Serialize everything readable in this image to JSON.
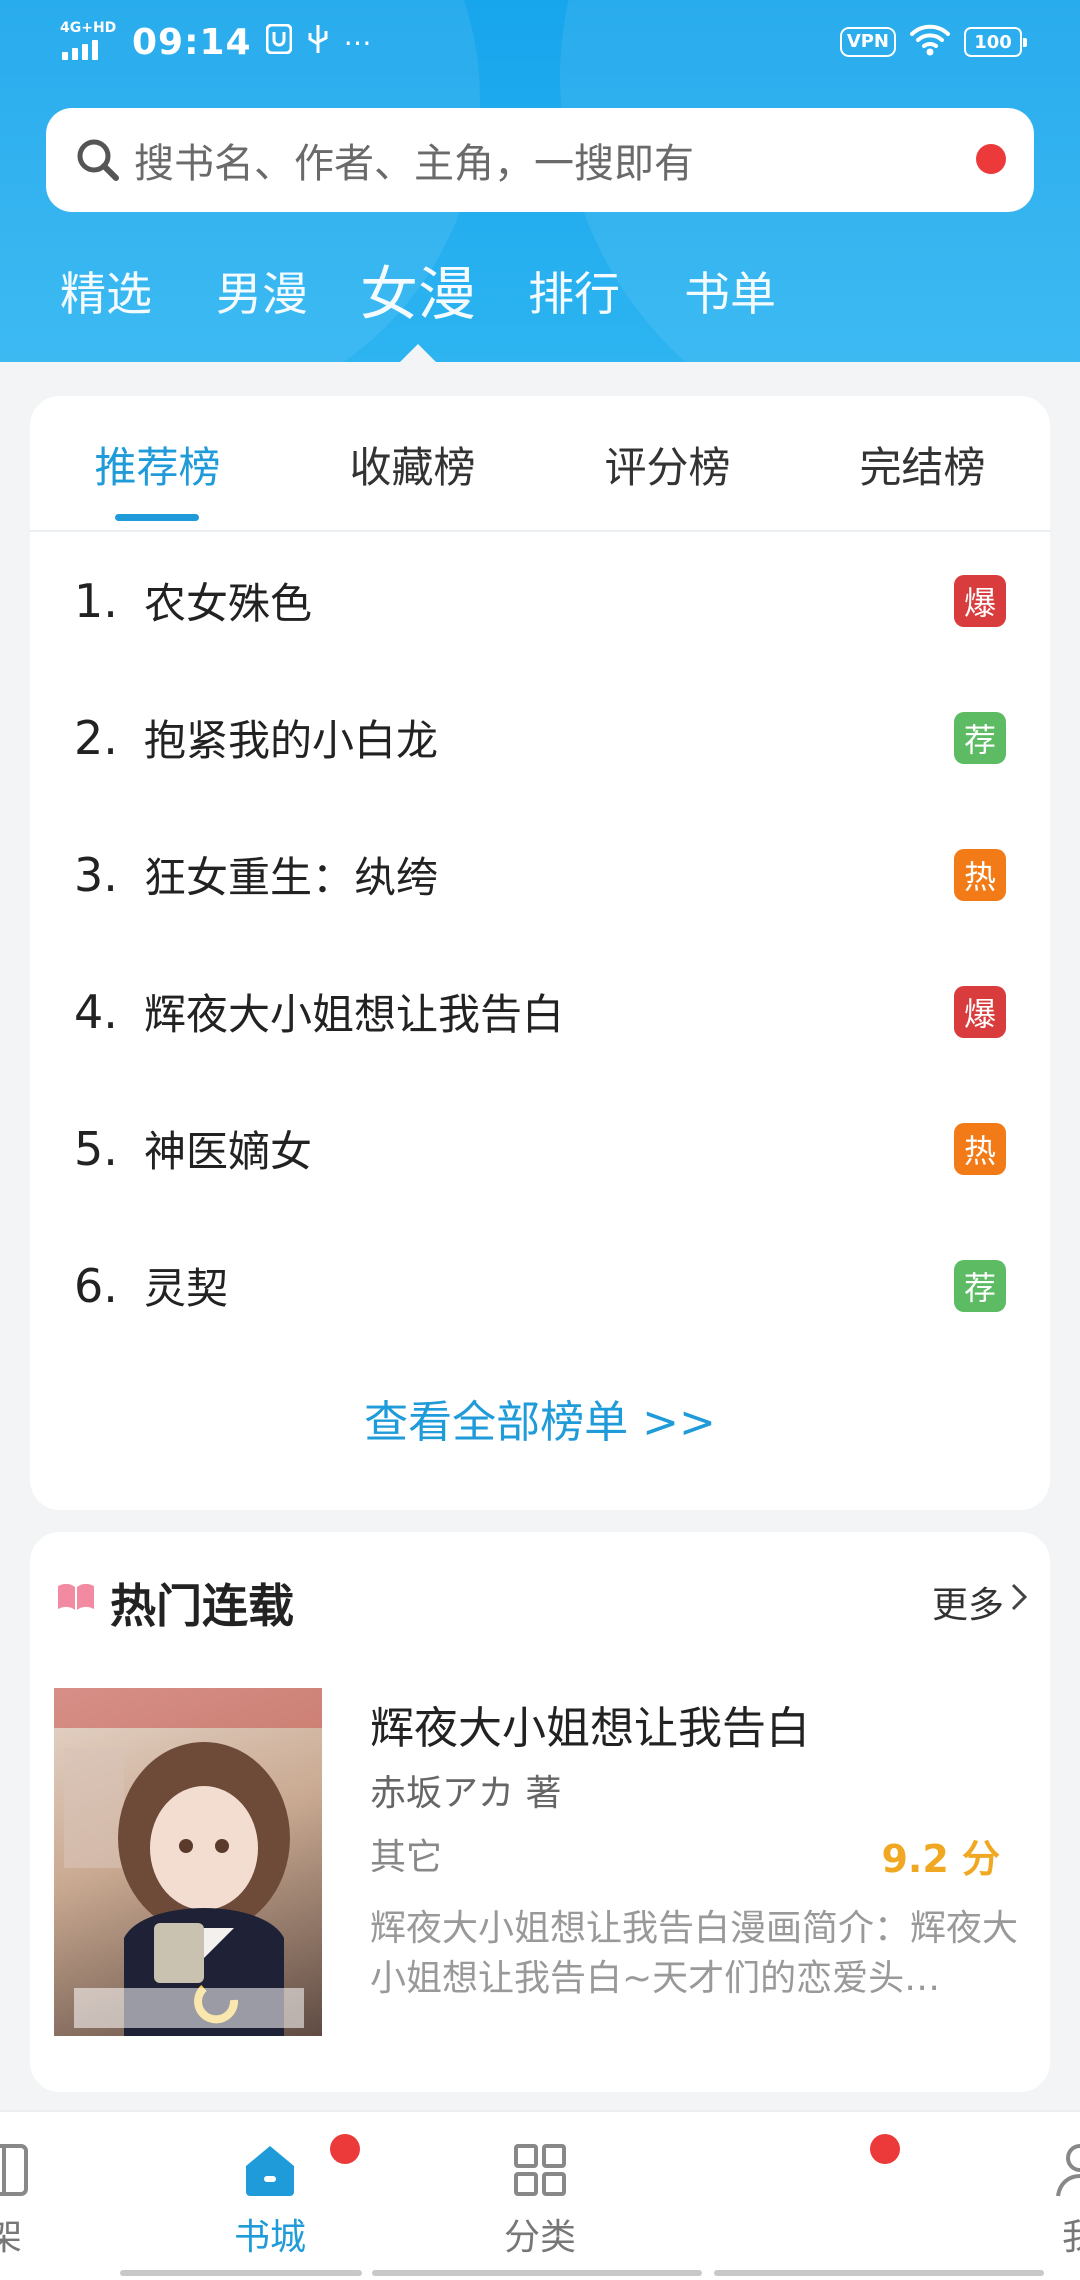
{
  "status_bar": {
    "network": "4G+HD",
    "time": "09:14",
    "vpn": "VPN",
    "battery": "100"
  },
  "search": {
    "placeholder": "搜书名、作者、主角，一搜即有"
  },
  "top_tabs": {
    "items": [
      "精选",
      "男漫",
      "女漫",
      "排行",
      "书单"
    ],
    "active": "女漫"
  },
  "ranking": {
    "tabs": [
      "推荐榜",
      "收藏榜",
      "评分榜",
      "完结榜"
    ],
    "active_tab": "推荐榜",
    "items": [
      {
        "rank": "1.",
        "title": "农女殊色",
        "badge": "爆",
        "badge_color": "#d93c3c"
      },
      {
        "rank": "2.",
        "title": "抱紧我的小白龙",
        "badge": "荐",
        "badge_color": "#5dbb63"
      },
      {
        "rank": "3.",
        "title": "狂女重生：纨绔",
        "badge": "热",
        "badge_color": "#f27a17"
      },
      {
        "rank": "4.",
        "title": "辉夜大小姐想让我告白",
        "badge": "爆",
        "badge_color": "#d93c3c"
      },
      {
        "rank": "5.",
        "title": "神医嫡女",
        "badge": "热",
        "badge_color": "#f27a17"
      },
      {
        "rank": "6.",
        "title": "灵契",
        "badge": "荐",
        "badge_color": "#5dbb63"
      }
    ],
    "view_all": "查看全部榜单 >>"
  },
  "hot_serial": {
    "icon": "open-book-icon",
    "title": "热门连载",
    "more": "更多",
    "book": {
      "title": "辉夜大小姐想让我告白",
      "author": "赤坂アカ 著",
      "genre": "其它",
      "score": "9.2 分",
      "description": "辉夜大小姐想让我告白漫画简介：辉夜大小姐想让我告白~天才们的恋爱头…"
    }
  },
  "bottom_nav": {
    "items": [
      {
        "label": "架",
        "icon": "bookshelf-icon"
      },
      {
        "label": "书城",
        "icon": "home-icon",
        "active": true
      },
      {
        "label": "分类",
        "icon": "grid-icon"
      },
      {
        "label": "",
        "icon": "discover-icon"
      },
      {
        "label": "我",
        "icon": "user-icon"
      }
    ]
  },
  "colors": {
    "brand_blue": "#1e9bd8",
    "header_blue": "#17a5ec",
    "score_orange": "#f0a823",
    "notification_red": "#ec3a3a"
  }
}
